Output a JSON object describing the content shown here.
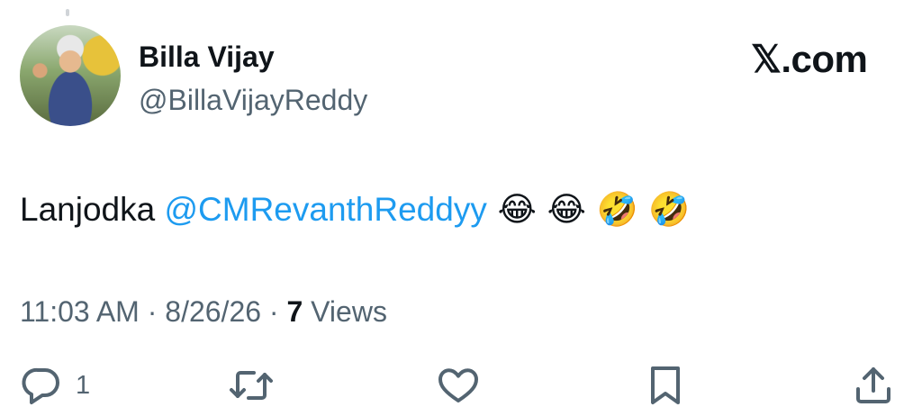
{
  "author": {
    "name": "Billa Vijay",
    "handle": "@BillaVijayReddy"
  },
  "brand": "𝕏.com",
  "tweet": {
    "text": "Lanjodka ",
    "mention": "@CMRevanthReddyy",
    "emojis": " 😂 😂 🤣 🤣"
  },
  "meta": {
    "time": "11:03 AM",
    "sep1": " · ",
    "date": "8/26/26",
    "sep2": " · ",
    "views_count": "7",
    "views_label": " Views"
  },
  "actions": {
    "reply_count": "1"
  },
  "colors": {
    "accent": "#1d9bf0",
    "text": "#0f1419",
    "secondary": "#536471"
  }
}
